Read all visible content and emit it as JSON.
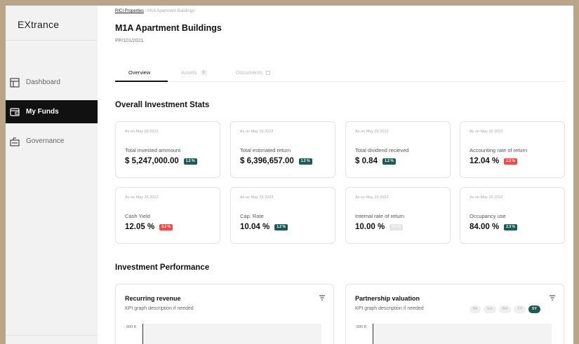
{
  "app": {
    "logo": "EXtrance"
  },
  "sidebar": {
    "items": [
      {
        "label": "Dashboard",
        "icon": "dashboard-icon",
        "active": false
      },
      {
        "label": "My Funds",
        "icon": "funds-icon",
        "active": true
      },
      {
        "label": "Governance",
        "icon": "governance-icon",
        "active": false
      }
    ]
  },
  "breadcrumb": {
    "parent": "RICI Properties",
    "separator": "/",
    "current": "M1A Apartment Buildings"
  },
  "page": {
    "title": "M1A Apartment Buildings",
    "code": "PP/101/2021"
  },
  "tabs": [
    {
      "label": "Overview",
      "active": true
    },
    {
      "label": "Assets",
      "count": "6"
    },
    {
      "label": "Documents"
    }
  ],
  "stats_section": {
    "title": "Overall Investment Stats"
  },
  "stats": [
    {
      "as_on": "As on May 26 2022",
      "label": "Total invested ammount",
      "value": "$ 5,247,000.00",
      "badge": "1.2 %",
      "badge_color": "#1d5b55"
    },
    {
      "as_on": "As on May 26 2022",
      "label": "Total estimated return",
      "value": "$ 6,396,657.00",
      "badge": "1.2 %",
      "badge_color": "#1d5b55"
    },
    {
      "as_on": "As on May 26 2022",
      "label": "Total dividend recieved",
      "value": "$ 0.84",
      "badge": "1.2 %",
      "badge_color": "#1d5b55"
    },
    {
      "as_on": "As on May 26 2022",
      "label": "Accounting rate of return",
      "value": "12.04 %",
      "badge": "2.3 %",
      "badge_color": "#ef4b4b"
    },
    {
      "as_on": "As on May 26 2022",
      "label": "Cash Yield",
      "value": "12.05 %",
      "badge": "0.2 %",
      "badge_color": "#ef4b4b"
    },
    {
      "as_on": "As on May 26 2022",
      "label": "Cap. Rate",
      "value": "10.04 %",
      "badge": "1.2 %",
      "badge_color": "#1d5b55"
    },
    {
      "as_on": "As on May 26 2022",
      "label": "Internal rate of return",
      "value": "10.00 %",
      "badge": "0.0 %",
      "badge_color": "#e5e5e5"
    },
    {
      "as_on": "As on May 26 2022",
      "label": "Occupancy use",
      "value": "84.00 %",
      "badge": "2.3 %",
      "badge_color": "#1d5b55"
    }
  ],
  "performance_section": {
    "title": "Investment Performance"
  },
  "performance": [
    {
      "title": "Recurring revenue",
      "description": "KPI graph description if needed",
      "y_top_label": "600 K"
    },
    {
      "title": "Partnership valuation",
      "description": "KPI graph description if needed",
      "y_top_label": "600 K",
      "ranges": [
        "5d",
        "1m",
        "6m",
        "1Y",
        "5Y"
      ],
      "active_range": "5Y"
    }
  ],
  "colors": {
    "accent": "#1d5b55",
    "negative": "#ef4b4b",
    "active_nav": "#111111"
  }
}
